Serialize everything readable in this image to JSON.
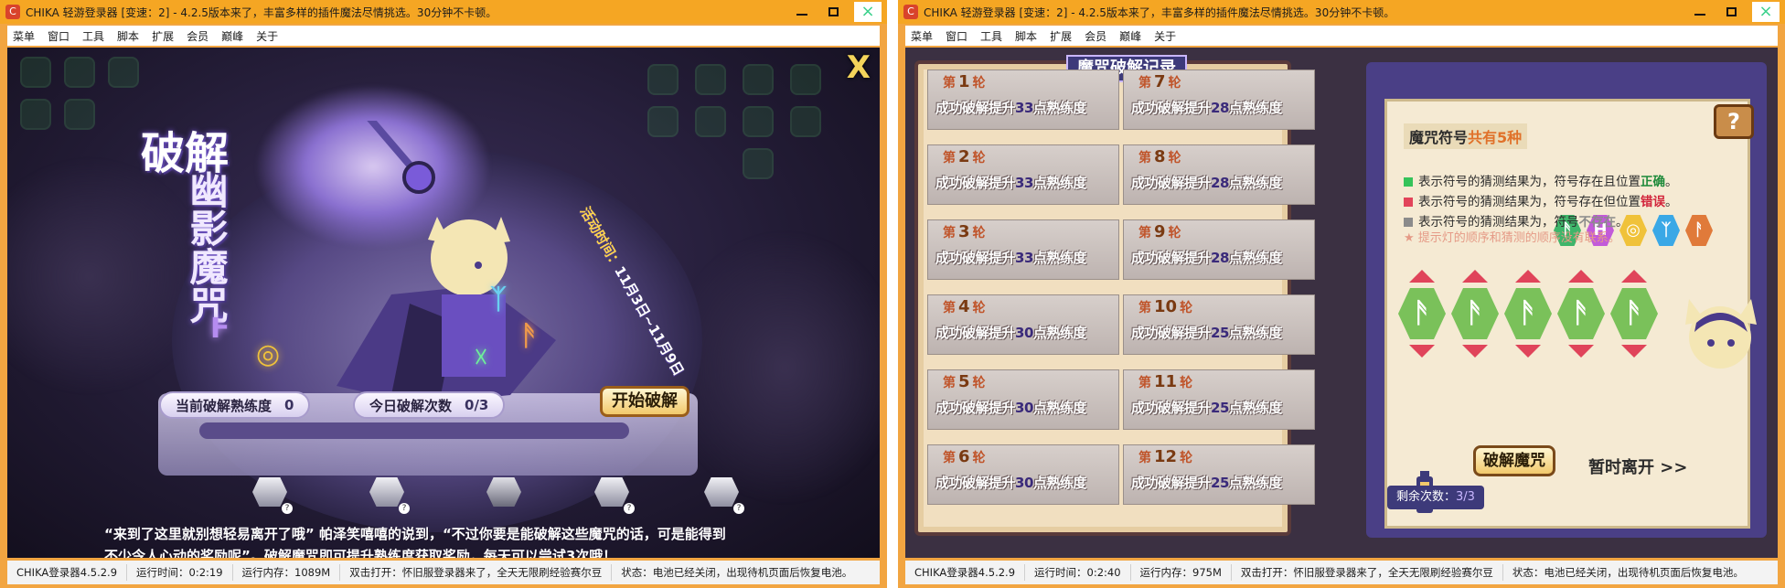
{
  "windows": [
    {
      "title": "CHIKA 轻游登录器 [变速：2] - 4.2.5版本来了，丰富多样的插件魔法尽情挑选。30分钟不卡顿。",
      "menu": [
        "菜单",
        "窗口",
        "工具",
        "脚本",
        "扩展",
        "会员",
        "巅峰",
        "关于"
      ],
      "status": [
        "CHIKA登录器4.5.2.9",
        "运行时间：0:2:19",
        "运行内存：1089M",
        "双击打开：怀旧服登录器来了，全天无限刷经验赛尔豆",
        "状态：电池已经关闭，出现待机页面后恢复电池。"
      ]
    },
    {
      "title": "CHIKA 轻游登录器 [变速：2] - 4.2.5版本来了，丰富多样的插件魔法尽情挑选。30分钟不卡顿。",
      "menu": [
        "菜单",
        "窗口",
        "工具",
        "脚本",
        "扩展",
        "会员",
        "巅峰",
        "关于"
      ],
      "status": [
        "CHIKA登录器4.5.2.9",
        "运行时间：0:2:40",
        "运行内存：975M",
        "双击打开：怀旧服登录器来了，全天无限刷经验赛尔豆",
        "状态：电池已经关闭，出现待机页面后恢复电池。"
      ]
    }
  ],
  "window_buttons": {
    "minimize": "–",
    "maximize": "□",
    "close": "×"
  },
  "left_game": {
    "close_glyph": "X",
    "title_line1": "破解",
    "title_line2": "幽影魔咒",
    "event_time_label": "活动时间：",
    "event_time_value": "11月3日~11月9日",
    "proficiency_label": "当前破解熟练度",
    "proficiency_value": "0",
    "daily_label": "今日破解次数",
    "daily_value": "0/3",
    "start_button": "开始破解",
    "reward_badges": [
      "?",
      "?",
      "?",
      "?"
    ],
    "story_line1": "“来到了这里就别想轻易离开了哦” 帕泽笑嘻嘻的说到，“不过你要是能破解这些魔咒的话，可是能得到",
    "story_line2": "不少令人心动的奖励呢”。破解魔咒即可提升熟练度获取奖励，每天可以尝试3次哦！",
    "runes": [
      "Ͱ",
      "◎",
      "ᛉ",
      "☓",
      "ᚫ"
    ]
  },
  "right_game": {
    "record_title": "魔咒破解记录",
    "round_prefix": "第",
    "round_suffix": "轮",
    "desc_prefix": "成功破解提升",
    "desc_suffix": "点熟练度",
    "records": [
      {
        "round": "1",
        "value": "33"
      },
      {
        "round": "2",
        "value": "33"
      },
      {
        "round": "3",
        "value": "33"
      },
      {
        "round": "4",
        "value": "30"
      },
      {
        "round": "5",
        "value": "30"
      },
      {
        "round": "6",
        "value": "30"
      },
      {
        "round": "7",
        "value": "28"
      },
      {
        "round": "8",
        "value": "28"
      },
      {
        "round": "9",
        "value": "28"
      },
      {
        "round": "10",
        "value": "25"
      },
      {
        "round": "11",
        "value": "25"
      },
      {
        "round": "12",
        "value": "25"
      }
    ],
    "symbols_label": "魔咒符号",
    "symbols_count": "共有5种",
    "symbol_glyphs": [
      "ᚫ",
      "H",
      "◎",
      "ᛉ",
      "ᚨ"
    ],
    "symbol_colors": [
      "#3fb56a",
      "#c25ad9",
      "#f0c23a",
      "#3aa8e6",
      "#e07a3a"
    ],
    "legend": [
      {
        "color": "#35c35a",
        "prefix": "表示符号的猜测结果为，符号存在且位置",
        "key": "正确",
        "key_color": "#1d8a3a",
        "suffix": "。"
      },
      {
        "color": "#e2445a",
        "prefix": "表示符号的猜测结果为，符号存在但位置",
        "key": "错误",
        "key_color": "#d2233a",
        "suffix": "。"
      },
      {
        "color": "#8b8b8b",
        "prefix": "表示符号的猜测结果为，符号",
        "key": "不存在",
        "key_color": "#8b8b8b",
        "suffix": "。"
      }
    ],
    "hint": "★ 提示灯的顺序和猜测的顺序没有联系。",
    "guess_glyphs": [
      "ᚫ",
      "ᚫ",
      "ᚫ",
      "ᚫ",
      "ᚫ"
    ],
    "crack_button": "破解魔咒",
    "leave_button": "暂时离开 >>",
    "remaining_label": "剩余次数：",
    "remaining_value": "3/3",
    "help_glyph": "?"
  }
}
